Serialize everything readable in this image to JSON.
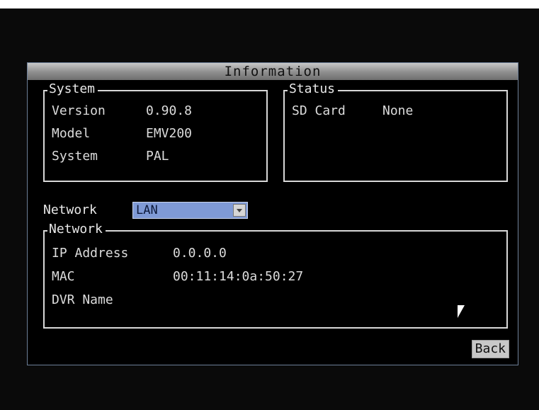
{
  "window": {
    "title": "Information"
  },
  "system_group": {
    "title": "System",
    "rows": [
      {
        "label": "Version",
        "value": "0.90.8"
      },
      {
        "label": "Model",
        "value": "EMV200"
      },
      {
        "label": "System",
        "value": "PAL"
      }
    ]
  },
  "status_group": {
    "title": "Status",
    "rows": [
      {
        "label": "SD Card",
        "value": "None"
      }
    ]
  },
  "network_select": {
    "label": "Network",
    "value": "LAN"
  },
  "network_group": {
    "title": "Network",
    "rows": [
      {
        "label": "IP Address",
        "value": "0.0.0.0"
      },
      {
        "label": "MAC",
        "value": "00:11:14:0a:50:27"
      },
      {
        "label": "DVR Name",
        "value": ""
      }
    ]
  },
  "buttons": {
    "back": "Back"
  },
  "colors": {
    "background": "#000000",
    "select_accent": "#7f9ad6",
    "border": "#d8d8d8"
  }
}
